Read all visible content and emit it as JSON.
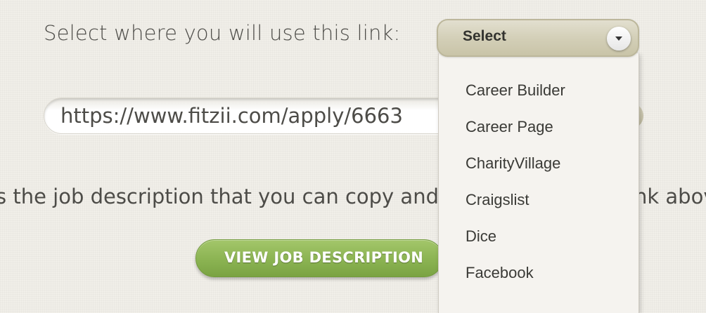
{
  "link_section": {
    "label": "Select where you will use this link:",
    "url": "https://www.fitzii.com/apply/6663"
  },
  "description": {
    "text_left": "s the job description that you can copy and pa",
    "text_right": "nk above"
  },
  "view_button": {
    "label": "VIEW JOB DESCRIPTION"
  },
  "select": {
    "value": "Select",
    "options": [
      "Career Builder",
      "Career Page",
      "CharityVillage",
      "Craigslist",
      "Dice",
      "Facebook"
    ]
  },
  "colors": {
    "button_green": "#8bb352",
    "select_bg": "#d2ceb6",
    "page_bg": "#f1efe9"
  }
}
